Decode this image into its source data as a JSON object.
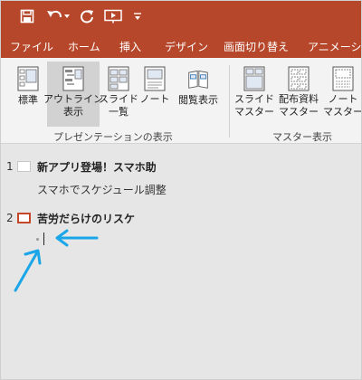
{
  "colors": {
    "accent": "#b7472a",
    "ribbon_bg": "#f3f3f3",
    "outline_bg": "#e6e6e6",
    "arrow": "#1aa6e8",
    "selected": "#c4472a"
  },
  "qat": [
    "save-icon",
    "undo-icon",
    "redo-icon",
    "from-beginning-icon",
    "customize-icon"
  ],
  "tabs": [
    "ファイル",
    "ホーム",
    "挿入",
    "デザイン",
    "画面切り替え",
    "アニメーション"
  ],
  "ribbon": {
    "presentation_views": {
      "label": "プレゼンテーションの表示",
      "buttons": [
        {
          "lines": [
            "標準"
          ],
          "icon": "normal-view-icon",
          "active": false
        },
        {
          "lines": [
            "アウトライン",
            "表示"
          ],
          "icon": "outline-view-icon",
          "active": true
        },
        {
          "lines": [
            "スライド",
            "一覧"
          ],
          "icon": "slide-sorter-icon",
          "active": false
        },
        {
          "lines": [
            "ノート"
          ],
          "icon": "notes-page-icon",
          "active": false
        },
        {
          "lines": [
            "閲覧表示"
          ],
          "icon": "reading-view-icon",
          "active": false
        }
      ]
    },
    "master_views": {
      "label": "マスター表示",
      "buttons": [
        {
          "lines": [
            "スライド",
            "マスター"
          ],
          "icon": "slide-master-icon"
        },
        {
          "lines": [
            "配布資料",
            "マスター"
          ],
          "icon": "handout-master-icon"
        },
        {
          "lines": [
            "ノート",
            "マスター"
          ],
          "icon": "notes-master-icon"
        }
      ]
    }
  },
  "outline": {
    "slides": [
      {
        "number": "1",
        "title": "新アプリ登場！スマホ助",
        "bullets": [
          "スマホでスケジュール調整"
        ],
        "selected": false
      },
      {
        "number": "2",
        "title": "苦労だらけのリスケ",
        "bullets": [],
        "selected": true
      }
    ]
  }
}
